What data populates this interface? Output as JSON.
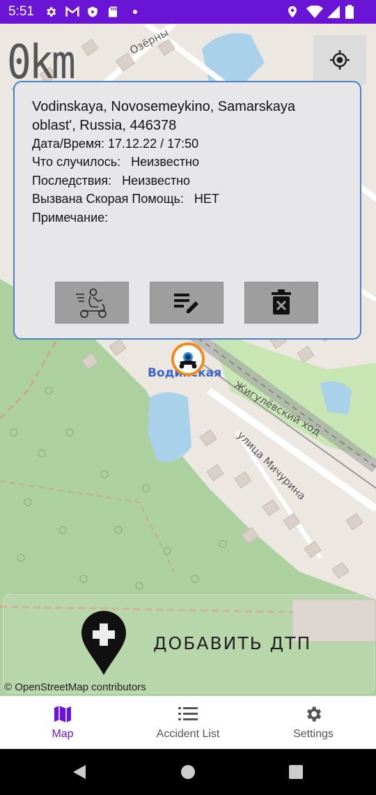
{
  "status_bar": {
    "time": "5:51",
    "left_icons": [
      "gear-icon",
      "gmail-icon",
      "shield-play-icon",
      "sd-card-icon",
      "dot-icon"
    ],
    "right_icons": [
      "location-icon",
      "wifi-icon",
      "signal-icon",
      "battery-icon"
    ]
  },
  "map": {
    "odometer": "0km",
    "labels": {
      "street_top": "Озёрны",
      "station": "Водинская",
      "railway": "Жигулёвский ход",
      "street": "улица Мичурина"
    },
    "attribution": "© OpenStreetMap contributors"
  },
  "popup": {
    "address": "Vodinskaya, Novosemeykino, Samarskaya oblast', Russia, 446378",
    "datetime": "Дата/Время: 17.12.22 / 17:50",
    "what_happened": "Что случилось:   Неизвестно",
    "consequences": "Последствия:   Неизвестно",
    "ambulance": "Вызвана Скорая Помощь:   НЕТ",
    "note": "Примечание:",
    "buttons": [
      "scooter-rider-icon",
      "edit-note-icon",
      "delete-icon"
    ]
  },
  "add_button": {
    "label": "ДОБАВИТЬ ДТП"
  },
  "bottom_nav": {
    "items": [
      {
        "label": "Map",
        "icon": "map-icon",
        "active": true
      },
      {
        "label": "Accident List",
        "icon": "list-icon",
        "active": false
      },
      {
        "label": "Settings",
        "icon": "settings-icon",
        "active": false
      }
    ]
  },
  "colors": {
    "status_bar": "#6a15d6",
    "accent": "#6a15d6",
    "popup_border": "#4a82c7",
    "marker_ring": "#f08a1c"
  }
}
